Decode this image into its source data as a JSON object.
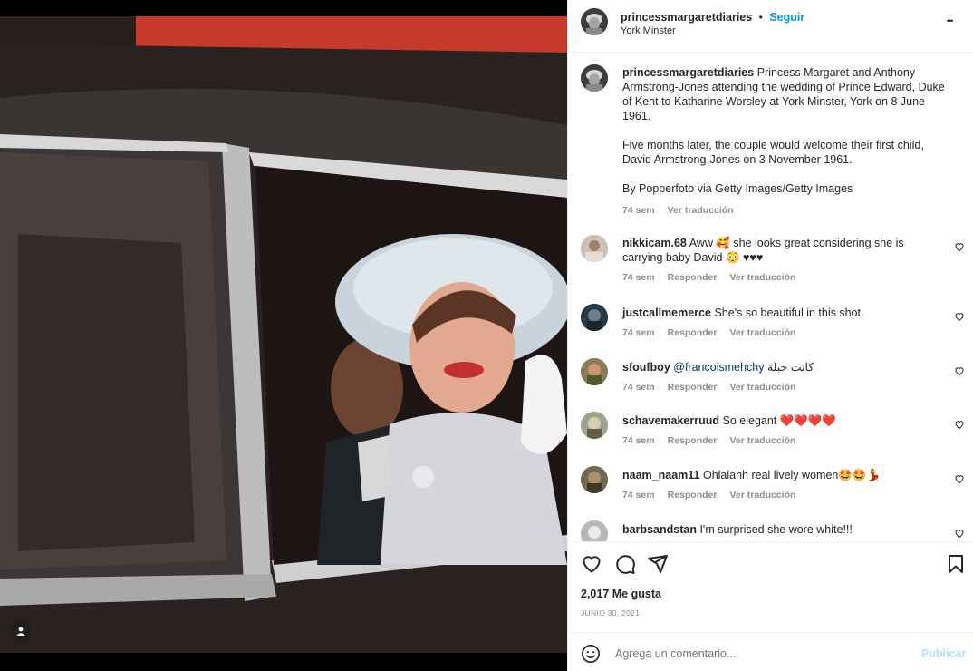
{
  "post": {
    "username": "princessmargaretdiaries",
    "separator": "•",
    "follow_label": "Seguir",
    "location": "York Minster",
    "more_label": "•••"
  },
  "caption": {
    "username": "princessmargaretdiaries",
    "p1": "Princess Margaret and Anthony Armstrong-Jones attending the wedding of Prince Edward, Duke of Kent to Katharine Worsley at York Minster, York on 8 June 1961.",
    "p2": "Five months later, the couple would welcome their first child, David Armstrong-Jones on 3 November 1961.",
    "p3": "By Popperfoto via Getty Images/Getty Images",
    "time": "74 sem",
    "translate": "Ver traducción"
  },
  "comments": [
    {
      "user": "nikkicam.68",
      "text": "Aww 🥰 she looks great considering she is carrying baby David 😳 ♥♥♥",
      "time": "74 sem",
      "reply": "Responder",
      "translate": "Ver traducción"
    },
    {
      "user": "justcallmemerce",
      "text": "She's so beautiful in this shot.",
      "time": "74 sem",
      "reply": "Responder",
      "translate": "Ver traducción"
    },
    {
      "user": "sfoufboy",
      "mention": "@francoismehchy",
      "text": "كانت حبلة",
      "time": "74 sem",
      "reply": "Responder",
      "translate": "Ver traducción"
    },
    {
      "user": "schavemakerruud",
      "text": "So elegant ❤️❤️❤️❤️",
      "time": "74 sem",
      "reply": "Responder",
      "translate": "Ver traducción"
    },
    {
      "user": "naam_naam11",
      "text": "Ohlalahh real lively women🤩🤩💃",
      "time": "74 sem",
      "reply": "Responder",
      "translate": "Ver traducción"
    },
    {
      "user": "barbsandstan",
      "text": "I'm surprised she wore white!!!"
    }
  ],
  "likes": "2,017 Me gusta",
  "date": "JUNIO 30, 2021",
  "add_comment": {
    "placeholder": "Agrega un comentario...",
    "publish": "Publicar"
  }
}
